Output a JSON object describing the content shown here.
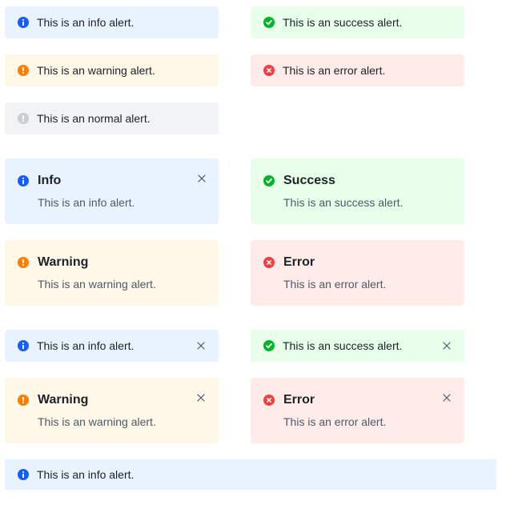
{
  "row1": {
    "info": {
      "message": "This is an info alert."
    },
    "success": {
      "message": "This is an success alert."
    }
  },
  "row2": {
    "warning": {
      "message": "This is an warning alert."
    },
    "error": {
      "message": "This is an error alert."
    }
  },
  "row3": {
    "normal": {
      "message": "This is an normal alert."
    }
  },
  "titled": {
    "info": {
      "title": "Info",
      "message": "This is an info alert."
    },
    "success": {
      "title": "Success",
      "message": "This is an success alert."
    },
    "warning": {
      "title": "Warning",
      "message": "This is an warning alert."
    },
    "error": {
      "title": "Error",
      "message": "This is an error alert."
    }
  },
  "closable": {
    "info": {
      "message": "This is an info alert."
    },
    "success": {
      "message": "This is an success alert."
    },
    "warning": {
      "title": "Warning",
      "message": "This is an warning alert."
    },
    "error": {
      "title": "Error",
      "message": "This is an error alert."
    }
  },
  "banner": {
    "message": "This is an info alert."
  },
  "colors": {
    "info": "#165dff",
    "success": "#00b42a",
    "warning": "#ff7d00",
    "error": "#f53f3f",
    "normal": "#c9cdd4"
  },
  "icons": {
    "info": "info-icon",
    "success": "check-icon",
    "warning": "exclamation-icon",
    "error": "close-circle-icon",
    "normal": "info-grey-icon",
    "close": "close-icon"
  }
}
